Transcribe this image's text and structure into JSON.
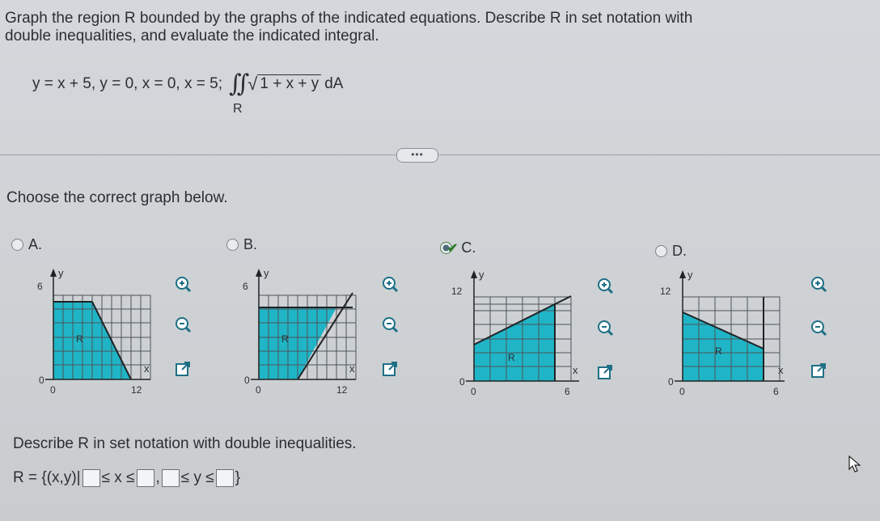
{
  "question": {
    "prompt_line1": "Graph the region R bounded by the graphs of the indicated equations. Describe R in set notation with",
    "prompt_line2": "double inequalities, and evaluate the indicated integral.",
    "equations": "y = x + 5, y = 0, x = 0, x = 5;",
    "radicand": "1 + x + y",
    "differential": "dA",
    "region_subscript": "R"
  },
  "more_button": "•••",
  "choose_text": "Choose the correct graph below.",
  "options": [
    {
      "letter": "A.",
      "selected": false,
      "y_max": "6",
      "x_max": "12",
      "origin_y": "0",
      "origin_x": "0",
      "axis_y": "y",
      "axis_x": "x",
      "region": "R"
    },
    {
      "letter": "B.",
      "selected": false,
      "y_max": "6",
      "x_max": "12",
      "origin_y": "0",
      "origin_x": "0",
      "axis_y": "y",
      "axis_x": "x",
      "region": "R"
    },
    {
      "letter": "C.",
      "selected": true,
      "y_max": "12",
      "x_max": "6",
      "origin_y": "0",
      "origin_x": "0",
      "axis_y": "y",
      "axis_x": "x",
      "region": "R"
    },
    {
      "letter": "D.",
      "selected": false,
      "y_max": "12",
      "x_max": "6",
      "origin_y": "0",
      "origin_x": "0",
      "axis_y": "y",
      "axis_x": "x",
      "region": "R"
    }
  ],
  "describe_text": "Describe R in set notation with double inequalities.",
  "set_notation": {
    "prefix": "R = {(x,y)|",
    "x_ineq": "≤ x ≤",
    "comma": ",",
    "y_ineq": "≤ y ≤",
    "suffix": "}"
  },
  "tools": {
    "zoom_in": "zoom-in-icon",
    "zoom_out": "zoom-out-icon",
    "popout": "popout-icon"
  },
  "colors": {
    "region_fill": "#1fb5c6",
    "check_green": "#2f7d2f",
    "grid": "#6d7378"
  }
}
